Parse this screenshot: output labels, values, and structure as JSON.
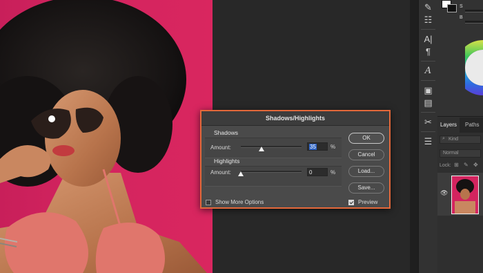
{
  "dialog": {
    "title": "Shadows/Highlights",
    "shadows": {
      "group_label": "Shadows",
      "amount_label": "Amount:",
      "amount_value": "35",
      "unit": "%"
    },
    "highlights": {
      "group_label": "Highlights",
      "amount_label": "Amount:",
      "amount_value": "0",
      "unit": "%"
    },
    "buttons": {
      "ok": "OK",
      "cancel": "Cancel",
      "load": "Load...",
      "save": "Save..."
    },
    "show_more_options": {
      "label": "Show More Options",
      "checked": false
    },
    "preview": {
      "label": "Preview",
      "checked": true
    }
  },
  "layers_panel": {
    "tabs": [
      "Layers",
      "Paths"
    ],
    "kind_filter_placeholder": "Kind",
    "blend_mode": "Normal",
    "lock_label": "Lock:"
  },
  "color_panel": {
    "labels": [
      "S",
      "B"
    ]
  },
  "colors": {
    "dialog_highlight_border": "#e4683a",
    "photo_background": "#d3245f",
    "selection_blue": "#2c62c4"
  }
}
